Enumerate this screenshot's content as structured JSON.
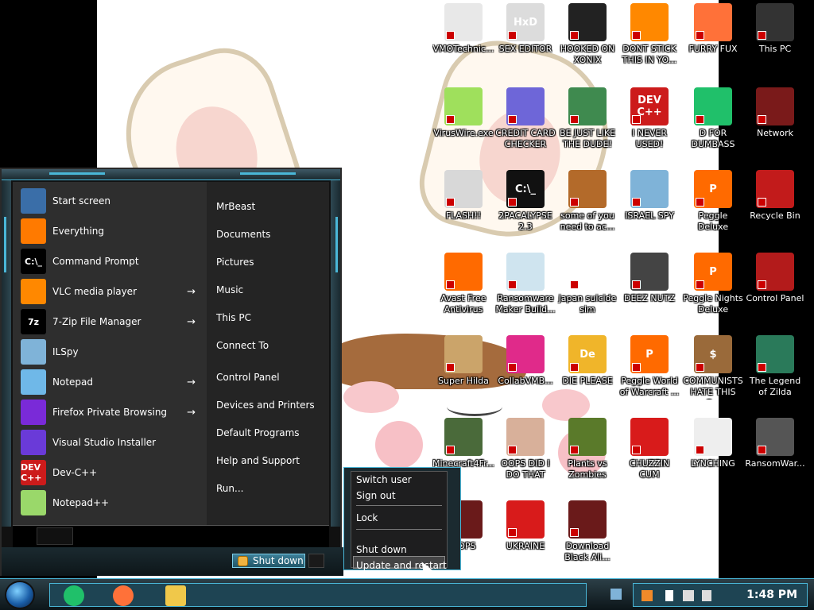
{
  "desktop_icons": [
    {
      "label": "VMOTechnic...",
      "short": "",
      "color": "#e8e8e8"
    },
    {
      "label": "SEX EDITOR",
      "short": "HxD",
      "color": "#dcdcdc"
    },
    {
      "label": "HOOKED ON XONIX",
      "short": "",
      "color": "#222222"
    },
    {
      "label": "DONT STICK THIS IN YO...",
      "short": "",
      "color": "#ff8800"
    },
    {
      "label": "FURRY FUX",
      "short": "",
      "color": "#ff7139"
    },
    {
      "label": "This PC",
      "short": "",
      "color": "#333333"
    },
    {
      "label": "VirusWire.exe",
      "short": "",
      "color": "#9fe05c"
    },
    {
      "label": "CREDIT CARD CHECKER",
      "short": "",
      "color": "#6e66d8"
    },
    {
      "label": "BE JUST LIKE THE DUDE!",
      "short": "",
      "color": "#3f8a4f"
    },
    {
      "label": "I NEVER USED!",
      "short": "DEV C++",
      "color": "#cc1b1b"
    },
    {
      "label": "D FOR DUMBASS",
      "short": "",
      "color": "#20c06a"
    },
    {
      "label": "Network",
      "short": "",
      "color": "#7a1a1a"
    },
    {
      "label": "FLASH!!",
      "short": "",
      "color": "#d8d8d8"
    },
    {
      "label": "2PACALYPSE 2.3",
      "short": "C:\\_",
      "color": "#111111"
    },
    {
      "label": "some of you need to ac...",
      "short": "",
      "color": "#b36a2a"
    },
    {
      "label": "ISRAEL SPY",
      "short": "",
      "color": "#7fb3d8"
    },
    {
      "label": "Peggle Deluxe",
      "short": "P",
      "color": "#ff6a00"
    },
    {
      "label": "Recycle Bin",
      "short": "",
      "color": "#c21b1b"
    },
    {
      "label": "Avast Free Antivirus",
      "short": "",
      "color": "#ff6a00"
    },
    {
      "label": "Ransomware Maker Build...",
      "short": "",
      "color": "#cfe4ef"
    },
    {
      "label": "japan suicide sim",
      "short": "",
      "color": "#ffffff"
    },
    {
      "label": "DEEZ NUTZ",
      "short": "",
      "color": "#444444"
    },
    {
      "label": "Peggle Nights Deluxe",
      "short": "P",
      "color": "#ff6a00"
    },
    {
      "label": "Control Panel",
      "short": "",
      "color": "#b31b1b"
    },
    {
      "label": "Super Hilda",
      "short": "",
      "color": "#cba46a"
    },
    {
      "label": "CollabVMB...",
      "short": "",
      "color": "#e02a8a"
    },
    {
      "label": "DIE PLEASE",
      "short": "De",
      "color": "#f0b52a"
    },
    {
      "label": "Peggle World of Warcraft ...",
      "short": "P",
      "color": "#ff6a00"
    },
    {
      "label": "COMMUNISTS HATE THIS G...",
      "short": "$",
      "color": "#9a6a3a"
    },
    {
      "label": "The Legend of Zilda",
      "short": "",
      "color": "#2a7a5a"
    },
    {
      "label": "Minecraft4Fr...",
      "short": "",
      "color": "#4a6a3a"
    },
    {
      "label": "OOPS DID I DO THAT",
      "short": "",
      "color": "#d8b09a"
    },
    {
      "label": "Plants vs Zombies",
      "short": "",
      "color": "#5a7a2a"
    },
    {
      "label": "CHUZZIN CUM",
      "short": "",
      "color": "#d81b1b"
    },
    {
      "label": "LYNCHING",
      "short": "",
      "color": "#eeeeee"
    },
    {
      "label": "RansomWar...",
      "short": "",
      "color": "#555555"
    },
    {
      "label": "OOPS",
      "short": "",
      "color": "#6a1a1a"
    },
    {
      "label": "UKRAINE",
      "short": "",
      "color": "#d81b1b"
    },
    {
      "label": "Download Black Ali...",
      "short": "",
      "color": "#6a1a1a"
    }
  ],
  "start_menu": {
    "programs": [
      {
        "label": "Start screen",
        "icon": "start-screen-icon",
        "icon_color": "#3a6ea8",
        "short": "",
        "has_arrow": false
      },
      {
        "label": "Everything",
        "icon": "everything-search-icon",
        "icon_color": "#ff7a00",
        "short": "",
        "has_arrow": false
      },
      {
        "label": "Command Prompt",
        "icon": "command-prompt-icon",
        "icon_color": "#000000",
        "short": "C:\\_",
        "has_arrow": false
      },
      {
        "label": "VLC media player",
        "icon": "vlc-icon",
        "icon_color": "#ff8800",
        "short": "",
        "has_arrow": true
      },
      {
        "label": "7-Zip File Manager",
        "icon": "seven-zip-icon",
        "icon_color": "#000000",
        "short": "7z",
        "has_arrow": true
      },
      {
        "label": "ILSpy",
        "icon": "ilspy-icon",
        "icon_color": "#7fb3d8",
        "short": "",
        "has_arrow": false
      },
      {
        "label": "Notepad",
        "icon": "notepad-icon",
        "icon_color": "#6fb8e8",
        "short": "",
        "has_arrow": true
      },
      {
        "label": "Firefox Private Browsing",
        "icon": "firefox-private-icon",
        "icon_color": "#7a2ad8",
        "short": "",
        "has_arrow": true
      },
      {
        "label": "Visual Studio Installer",
        "icon": "visual-studio-installer-icon",
        "icon_color": "#6a3ad8",
        "short": "",
        "has_arrow": false
      },
      {
        "label": "Dev-C++",
        "icon": "dev-cpp-icon",
        "icon_color": "#cc1b1b",
        "short": "DEV C++",
        "has_arrow": false
      },
      {
        "label": "Notepad++",
        "icon": "notepad-plus-plus-icon",
        "icon_color": "#9ad86a",
        "short": "",
        "has_arrow": false
      }
    ],
    "places": [
      "MrBeast",
      "Documents",
      "Pictures",
      "Music",
      "This PC",
      "Connect To",
      "Control Panel",
      "Devices and Printers",
      "Default Programs",
      "Help and Support",
      "Run..."
    ],
    "shutdown_label": "Shut down"
  },
  "power_menu": {
    "group1": [
      "Switch user",
      "Sign out"
    ],
    "lock": "Lock",
    "shut_down": "Shut down",
    "update_restart": "Update and restart"
  },
  "taskbar": {
    "pinned": [
      {
        "name": "d-for-dumbass-icon",
        "color": "#20c06a"
      },
      {
        "name": "firefox-icon",
        "color": "#ff7139"
      },
      {
        "name": "file-explorer-icon",
        "color": "#f0c84a"
      }
    ],
    "clock": "1:48 PM"
  }
}
